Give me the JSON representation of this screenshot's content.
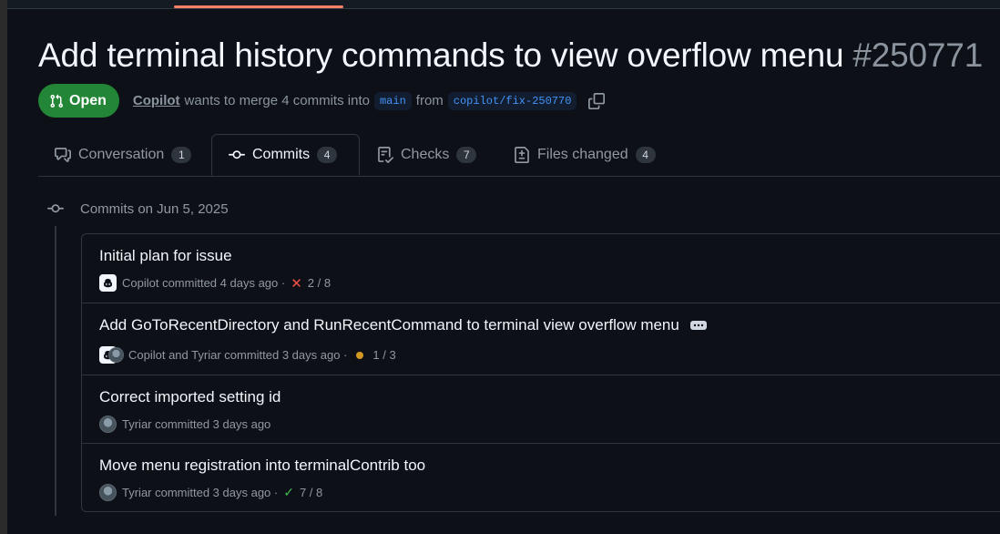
{
  "pr": {
    "title": "Add terminal history commands to view overflow menu",
    "number": "#250771",
    "state": "Open",
    "author": "Copilot",
    "merge_text": "wants to merge 4 commits into",
    "base_branch": "main",
    "from_text": "from",
    "head_branch": "copilot/fix-250770"
  },
  "tabs": [
    {
      "label": "Conversation",
      "count": "1",
      "icon": "conversation-icon"
    },
    {
      "label": "Commits",
      "count": "4",
      "icon": "commit-icon",
      "selected": true
    },
    {
      "label": "Checks",
      "count": "7",
      "icon": "checklist-icon"
    },
    {
      "label": "Files changed",
      "count": "4",
      "icon": "file-diff-icon"
    }
  ],
  "timeline": {
    "heading": "Commits on Jun 5, 2025"
  },
  "commits": [
    {
      "title": "Initial plan for issue",
      "meta": "Copilot committed 4 days ago ·",
      "status": "fail",
      "status_text": "2 / 8"
    },
    {
      "title": "Add GoToRecentDirectory and RunRecentCommand to terminal view overflow menu",
      "meta": "Copilot and Tyriar committed 3 days ago ·",
      "status": "pending",
      "status_text": "1 / 3"
    },
    {
      "title": "Correct imported setting id",
      "meta": "Tyriar committed 3 days ago",
      "status": "none",
      "status_text": ""
    },
    {
      "title": "Move menu registration into terminalContrib too",
      "meta": "Tyriar committed 3 days ago ·",
      "status": "success",
      "status_text": "7 / 8"
    }
  ],
  "colors": {
    "open_badge": "#238636",
    "accent_link": "#4493f8",
    "fail": "#f85149",
    "pending": "#d29922",
    "success": "#3fb950"
  }
}
